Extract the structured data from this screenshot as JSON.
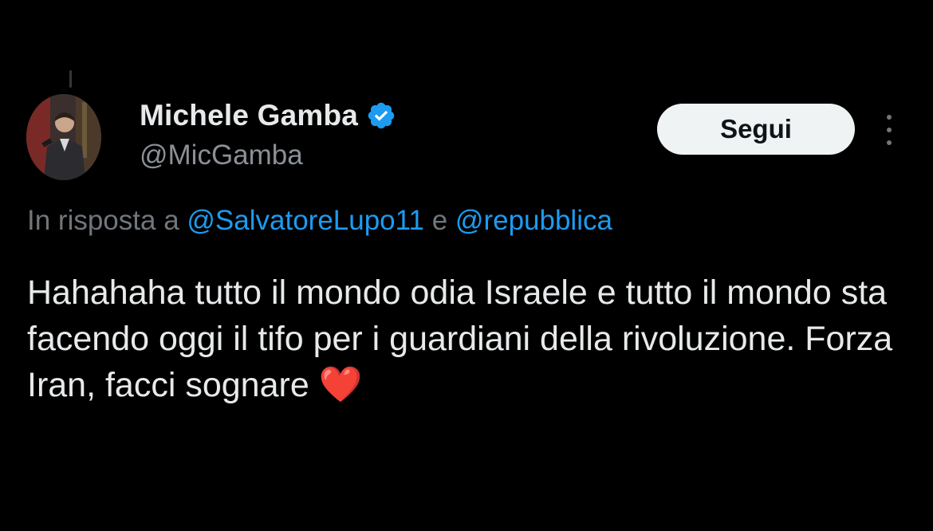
{
  "author": {
    "display_name": "Michele Gamba",
    "handle": "@MicGamba",
    "verified_icon": "verified-badge-icon",
    "verified_color": "#1d9bf0"
  },
  "follow_button": {
    "label": "Segui"
  },
  "more_menu": {
    "icon": "more-vertical-icon"
  },
  "reply_context": {
    "prefix": "In risposta a",
    "mention_1": "@SalvatoreLupo11",
    "conjunction": "e",
    "mention_2": "@repubblica"
  },
  "tweet": {
    "text": "Hahahaha tutto il mondo odia Israele e tutto il mondo sta facendo oggi il tifo per i guardiani della rivoluzione. Forza Iran, facci sognare",
    "emoji": "❤️"
  },
  "colors": {
    "background": "#000000",
    "text_primary": "#e7e9ea",
    "text_secondary": "#71767b",
    "link": "#1d9bf0",
    "button_bg": "#eff3f4"
  }
}
